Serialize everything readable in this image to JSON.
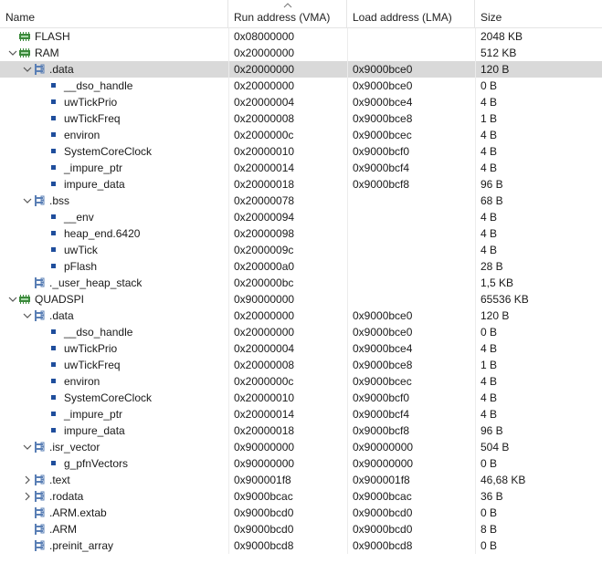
{
  "header": {
    "name": "Name",
    "run": "Run address (VMA)",
    "load": "Load address (LMA)",
    "size": "Size"
  },
  "rows": [
    {
      "name": "FLASH",
      "run": "0x08000000",
      "load": "",
      "size": "2048 KB",
      "icon": "memory-chip-icon",
      "level": 0,
      "twisty": ""
    },
    {
      "name": "RAM",
      "run": "0x20000000",
      "load": "",
      "size": "512 KB",
      "icon": "memory-chip-icon",
      "level": 0,
      "twisty": "expanded"
    },
    {
      "name": ".data",
      "run": "0x20000000",
      "load": "0x9000bce0",
      "size": "120 B",
      "icon": "section-icon",
      "level": 1,
      "twisty": "expanded",
      "selected": true
    },
    {
      "name": "__dso_handle",
      "run": "0x20000000",
      "load": "0x9000bce0",
      "size": "0 B",
      "icon": "symbol-icon",
      "level": 2,
      "twisty": ""
    },
    {
      "name": "uwTickPrio",
      "run": "0x20000004",
      "load": "0x9000bce4",
      "size": "4 B",
      "icon": "symbol-icon",
      "level": 2,
      "twisty": ""
    },
    {
      "name": "uwTickFreq",
      "run": "0x20000008",
      "load": "0x9000bce8",
      "size": "1 B",
      "icon": "symbol-icon",
      "level": 2,
      "twisty": ""
    },
    {
      "name": "environ",
      "run": "0x2000000c",
      "load": "0x9000bcec",
      "size": "4 B",
      "icon": "symbol-icon",
      "level": 2,
      "twisty": ""
    },
    {
      "name": "SystemCoreClock",
      "run": "0x20000010",
      "load": "0x9000bcf0",
      "size": "4 B",
      "icon": "symbol-icon",
      "level": 2,
      "twisty": ""
    },
    {
      "name": "_impure_ptr",
      "run": "0x20000014",
      "load": "0x9000bcf4",
      "size": "4 B",
      "icon": "symbol-icon",
      "level": 2,
      "twisty": ""
    },
    {
      "name": "impure_data",
      "run": "0x20000018",
      "load": "0x9000bcf8",
      "size": "96 B",
      "icon": "symbol-icon",
      "level": 2,
      "twisty": ""
    },
    {
      "name": ".bss",
      "run": "0x20000078",
      "load": "",
      "size": "68 B",
      "icon": "section-icon",
      "level": 1,
      "twisty": "expanded"
    },
    {
      "name": "__env",
      "run": "0x20000094",
      "load": "",
      "size": "4 B",
      "icon": "symbol-icon",
      "level": 2,
      "twisty": ""
    },
    {
      "name": "heap_end.6420",
      "run": "0x20000098",
      "load": "",
      "size": "4 B",
      "icon": "symbol-icon",
      "level": 2,
      "twisty": ""
    },
    {
      "name": "uwTick",
      "run": "0x2000009c",
      "load": "",
      "size": "4 B",
      "icon": "symbol-icon",
      "level": 2,
      "twisty": ""
    },
    {
      "name": "pFlash",
      "run": "0x200000a0",
      "load": "",
      "size": "28 B",
      "icon": "symbol-icon",
      "level": 2,
      "twisty": ""
    },
    {
      "name": "._user_heap_stack",
      "run": "0x200000bc",
      "load": "",
      "size": "1,5 KB",
      "icon": "section-icon",
      "level": 1,
      "twisty": ""
    },
    {
      "name": "QUADSPI",
      "run": "0x90000000",
      "load": "",
      "size": "65536 KB",
      "icon": "memory-chip-icon",
      "level": 0,
      "twisty": "expanded"
    },
    {
      "name": ".data",
      "run": "0x20000000",
      "load": "0x9000bce0",
      "size": "120 B",
      "icon": "section-icon",
      "level": 1,
      "twisty": "expanded"
    },
    {
      "name": "__dso_handle",
      "run": "0x20000000",
      "load": "0x9000bce0",
      "size": "0 B",
      "icon": "symbol-icon",
      "level": 2,
      "twisty": ""
    },
    {
      "name": "uwTickPrio",
      "run": "0x20000004",
      "load": "0x9000bce4",
      "size": "4 B",
      "icon": "symbol-icon",
      "level": 2,
      "twisty": ""
    },
    {
      "name": "uwTickFreq",
      "run": "0x20000008",
      "load": "0x9000bce8",
      "size": "1 B",
      "icon": "symbol-icon",
      "level": 2,
      "twisty": ""
    },
    {
      "name": "environ",
      "run": "0x2000000c",
      "load": "0x9000bcec",
      "size": "4 B",
      "icon": "symbol-icon",
      "level": 2,
      "twisty": ""
    },
    {
      "name": "SystemCoreClock",
      "run": "0x20000010",
      "load": "0x9000bcf0",
      "size": "4 B",
      "icon": "symbol-icon",
      "level": 2,
      "twisty": ""
    },
    {
      "name": "_impure_ptr",
      "run": "0x20000014",
      "load": "0x9000bcf4",
      "size": "4 B",
      "icon": "symbol-icon",
      "level": 2,
      "twisty": ""
    },
    {
      "name": "impure_data",
      "run": "0x20000018",
      "load": "0x9000bcf8",
      "size": "96 B",
      "icon": "symbol-icon",
      "level": 2,
      "twisty": ""
    },
    {
      "name": ".isr_vector",
      "run": "0x90000000",
      "load": "0x90000000",
      "size": "504 B",
      "icon": "section-icon",
      "level": 1,
      "twisty": "expanded"
    },
    {
      "name": "g_pfnVectors",
      "run": "0x90000000",
      "load": "0x90000000",
      "size": "0 B",
      "icon": "symbol-icon",
      "level": 2,
      "twisty": ""
    },
    {
      "name": ".text",
      "run": "0x900001f8",
      "load": "0x900001f8",
      "size": "46,68 KB",
      "icon": "section-icon",
      "level": 1,
      "twisty": "collapsed"
    },
    {
      "name": ".rodata",
      "run": "0x9000bcac",
      "load": "0x9000bcac",
      "size": "36 B",
      "icon": "section-icon",
      "level": 1,
      "twisty": "collapsed"
    },
    {
      "name": ".ARM.extab",
      "run": "0x9000bcd0",
      "load": "0x9000bcd0",
      "size": "0 B",
      "icon": "section-icon",
      "level": 1,
      "twisty": ""
    },
    {
      "name": ".ARM",
      "run": "0x9000bcd0",
      "load": "0x9000bcd0",
      "size": "8 B",
      "icon": "section-icon",
      "level": 1,
      "twisty": ""
    },
    {
      "name": ".preinit_array",
      "run": "0x9000bcd8",
      "load": "0x9000bcd8",
      "size": "0 B",
      "icon": "section-icon",
      "level": 1,
      "twisty": ""
    }
  ]
}
